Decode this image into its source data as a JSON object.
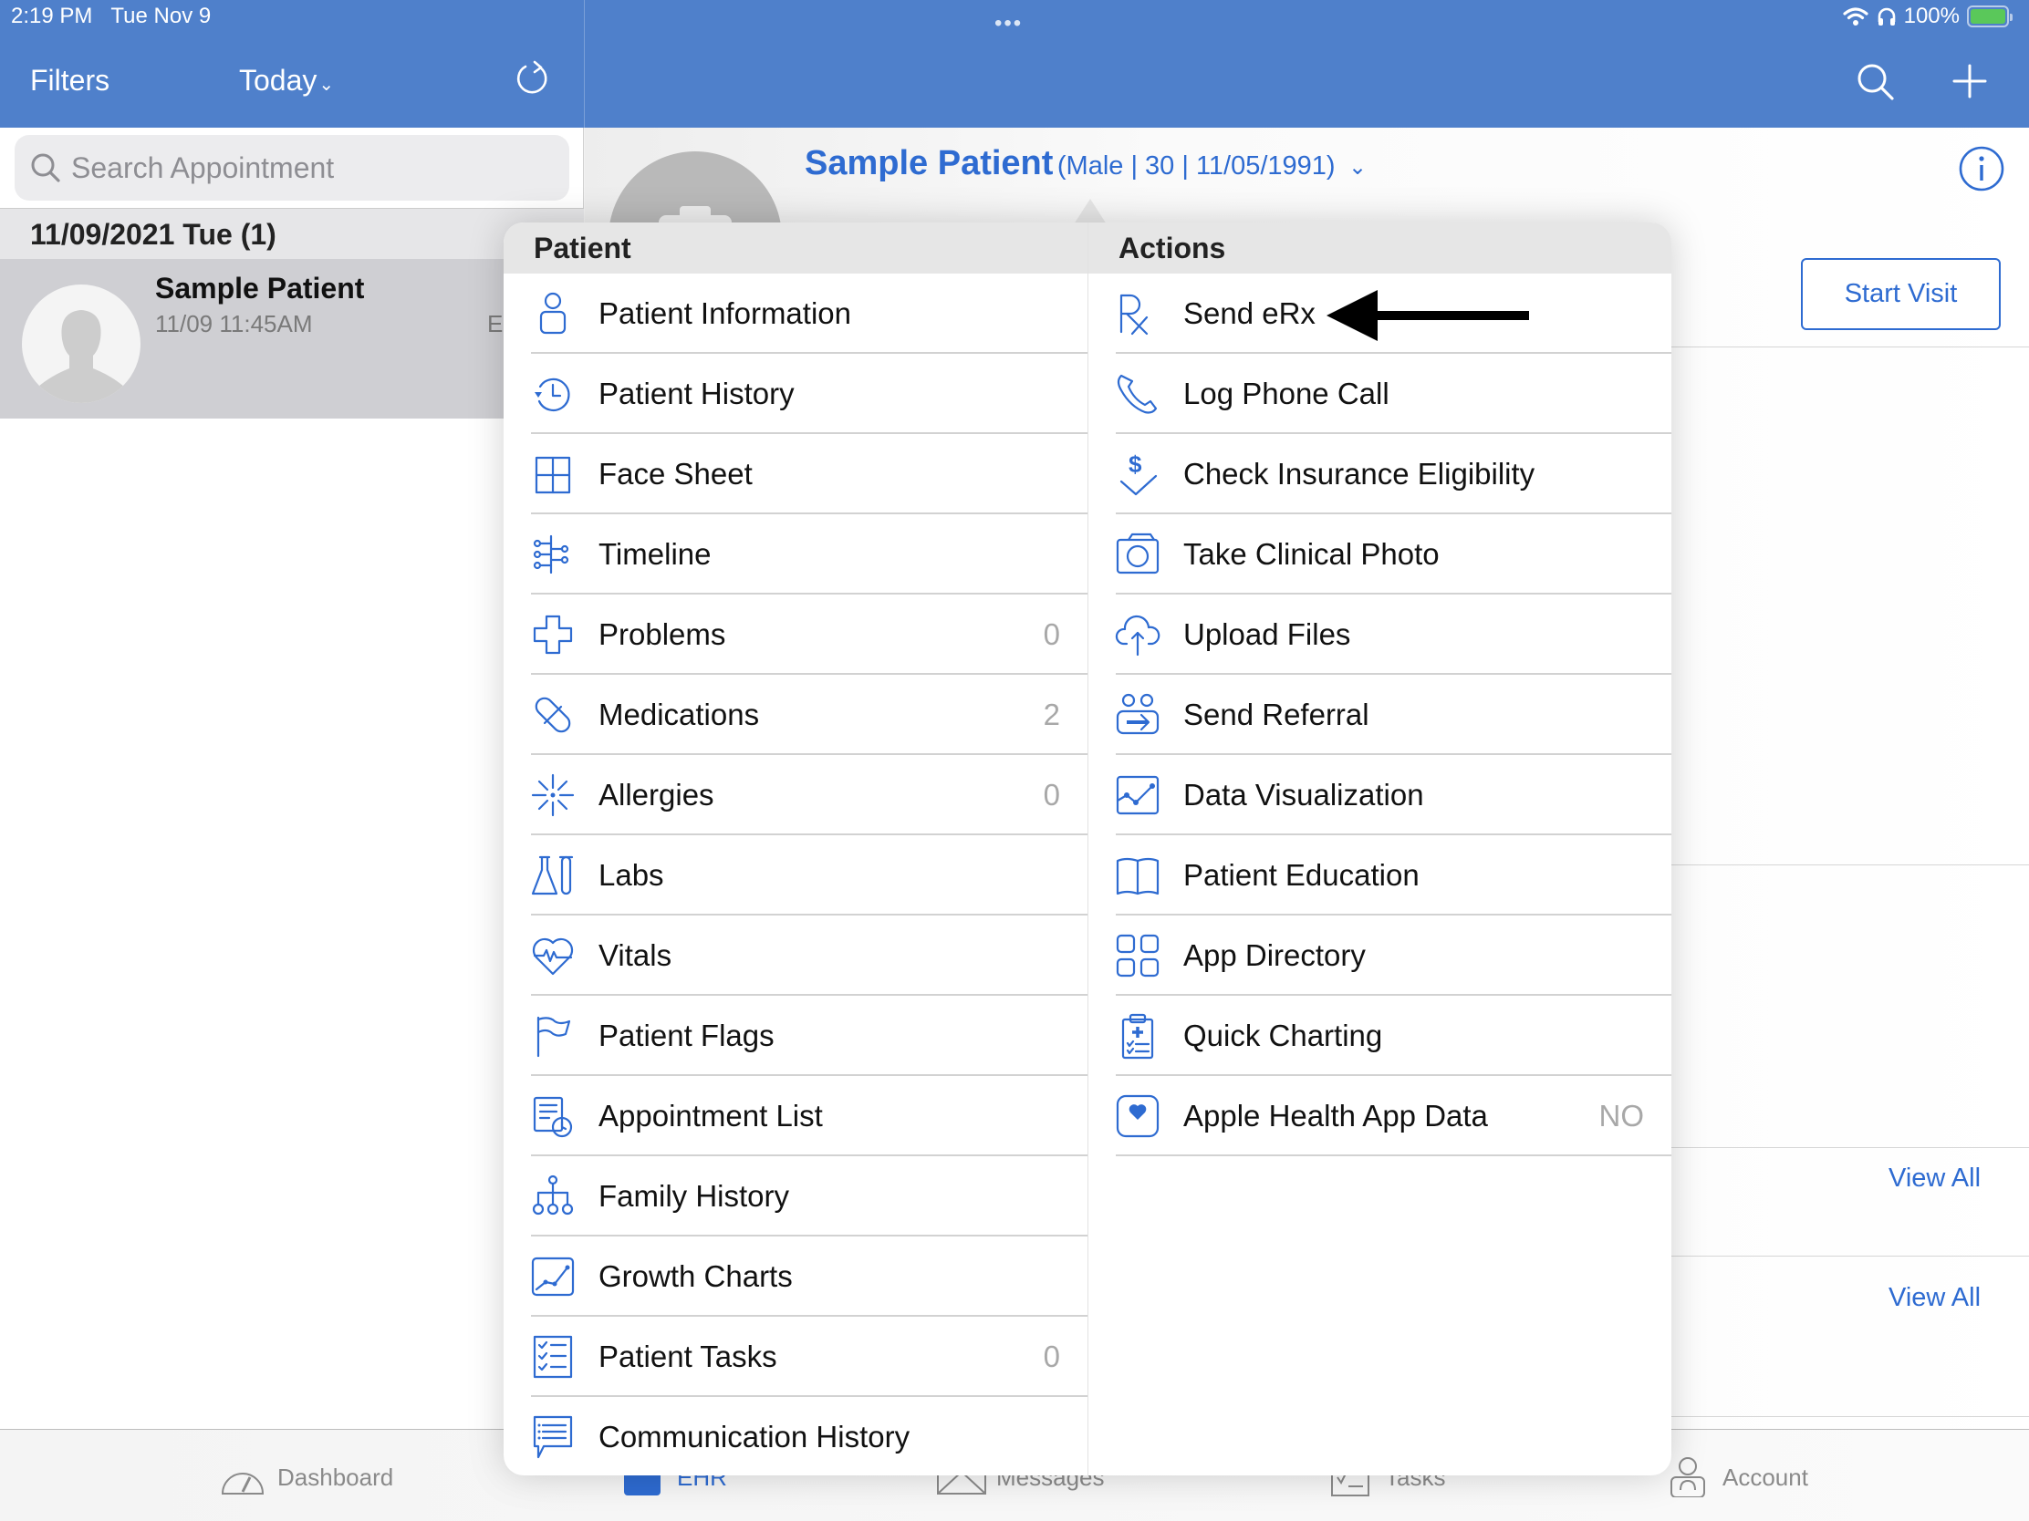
{
  "status_bar": {
    "time": "2:19 PM",
    "date": "Tue Nov 9",
    "battery": "100%",
    "multitask_dots": "•••"
  },
  "nav": {
    "filters_label": "Filters",
    "today_label": "Today",
    "today_chevron": "⌄"
  },
  "left_pane": {
    "search_placeholder": "Search Appointment",
    "date_header": "11/09/2021 Tue (1)",
    "appointment": {
      "name": "Sample Patient",
      "time": "11/09 11:45AM",
      "extra": "E"
    }
  },
  "patient_header": {
    "name": "Sample Patient",
    "meta": "(Male | 30 | 11/05/1991)",
    "chevron": "⌄",
    "start_visit": "Start Visit",
    "view_all_1": "View All",
    "view_all_2": "View All"
  },
  "popover": {
    "patient_header": "Patient",
    "actions_header": "Actions",
    "patient_items": [
      {
        "label": "Patient Information",
        "count": "",
        "icon": "person-icon"
      },
      {
        "label": "Patient History",
        "count": "",
        "icon": "history-icon"
      },
      {
        "label": "Face Sheet",
        "count": "",
        "icon": "grid-icon"
      },
      {
        "label": "Timeline",
        "count": "",
        "icon": "timeline-icon"
      },
      {
        "label": "Problems",
        "count": "0",
        "icon": "medical-cross-icon"
      },
      {
        "label": "Medications",
        "count": "2",
        "icon": "pill-icon"
      },
      {
        "label": "Allergies",
        "count": "0",
        "icon": "allergy-icon"
      },
      {
        "label": "Labs",
        "count": "",
        "icon": "flask-icon"
      },
      {
        "label": "Vitals",
        "count": "",
        "icon": "heart-pulse-icon"
      },
      {
        "label": "Patient Flags",
        "count": "",
        "icon": "flag-icon"
      },
      {
        "label": "Appointment List",
        "count": "",
        "icon": "appointment-list-icon"
      },
      {
        "label": "Family History",
        "count": "",
        "icon": "family-tree-icon"
      },
      {
        "label": "Growth Charts",
        "count": "",
        "icon": "growth-chart-icon"
      },
      {
        "label": "Patient Tasks",
        "count": "0",
        "icon": "checklist-icon"
      },
      {
        "label": "Communication History",
        "count": "",
        "icon": "chat-list-icon"
      }
    ],
    "action_items": [
      {
        "label": "Send eRx",
        "count": "",
        "icon": "rx-icon"
      },
      {
        "label": "Log Phone Call",
        "count": "",
        "icon": "phone-icon"
      },
      {
        "label": "Check Insurance Eligibility",
        "count": "",
        "icon": "dollar-check-icon"
      },
      {
        "label": "Take Clinical Photo",
        "count": "",
        "icon": "camera-icon"
      },
      {
        "label": "Upload Files",
        "count": "",
        "icon": "cloud-upload-icon"
      },
      {
        "label": "Send Referral",
        "count": "",
        "icon": "referral-icon"
      },
      {
        "label": "Data Visualization",
        "count": "",
        "icon": "line-chart-icon"
      },
      {
        "label": "Patient Education",
        "count": "",
        "icon": "book-icon"
      },
      {
        "label": "App Directory",
        "count": "",
        "icon": "app-grid-icon"
      },
      {
        "label": "Quick Charting",
        "count": "",
        "icon": "clipboard-icon"
      },
      {
        "label": "Apple Health App Data",
        "count": "NO",
        "icon": "health-heart-icon"
      }
    ]
  },
  "tab_bar": {
    "tabs": [
      {
        "label": "Dashboard",
        "active": false
      },
      {
        "label": "EHR",
        "active": true
      },
      {
        "label": "Messages",
        "active": false
      },
      {
        "label": "Tasks",
        "active": false
      },
      {
        "label": "Account",
        "active": false
      }
    ]
  },
  "colors": {
    "brand_blue": "#4f80cb",
    "accent_blue": "#2e6bd1",
    "battery_green": "#5ac85a"
  }
}
